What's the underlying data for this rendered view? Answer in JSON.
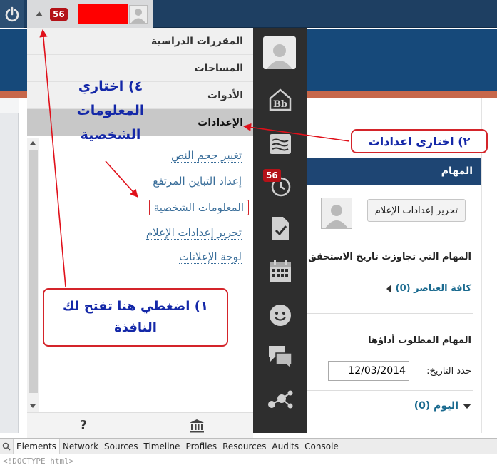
{
  "topbar": {
    "notification_count": "56"
  },
  "menu": {
    "items": [
      {
        "label": "المقررات الدراسية"
      },
      {
        "label": "المساحات"
      },
      {
        "label": "الأدوات"
      },
      {
        "label": "الإعدادات"
      }
    ]
  },
  "settings_links": [
    {
      "label": "تغيير حجم النص"
    },
    {
      "label": "إعداد التباين المرتفع"
    },
    {
      "label": "المعلومات الشخصية"
    },
    {
      "label": "تحرير إعدادات الإعلام"
    },
    {
      "label": "لوحة الإعلانات"
    }
  ],
  "icon_nav": {
    "due_badge": "56",
    "icons": [
      "blackboard-icon",
      "stream-icon",
      "due-clock-icon",
      "grades-icon",
      "calendar-icon",
      "smiley-icon",
      "messages-icon",
      "connections-icon"
    ]
  },
  "panel": {
    "title": "المهام",
    "notification_settings_button": "تحرير إعدادات الإعلام",
    "overdue_title": "المهام التي تجاوزت تاريخ الاستحقق",
    "all_items": "كافة العناصر (0)",
    "tasks_title": "المهام المطلوب أداؤها",
    "due_date_label": "حدد التاريخ:",
    "due_date_value": "12/03/2014",
    "today": "اليوم (0)"
  },
  "annotations": {
    "step1": "١) اضغطي هنا تفتح لك النافذة",
    "step2": "٢) اختاري اعدادات",
    "step4_line1": "٤) اختاري",
    "step4_line2": "المعلومات",
    "step4_line3": "الشخصية",
    "color_text": "#1428a8",
    "color_arrow": "#e0101a"
  },
  "devtools": {
    "tabs": [
      "Elements",
      "Network",
      "Sources",
      "Timeline",
      "Profiles",
      "Resources",
      "Audits",
      "Console"
    ],
    "active_tab": "Elements",
    "first_line": "<!DOCTYPE html>"
  }
}
